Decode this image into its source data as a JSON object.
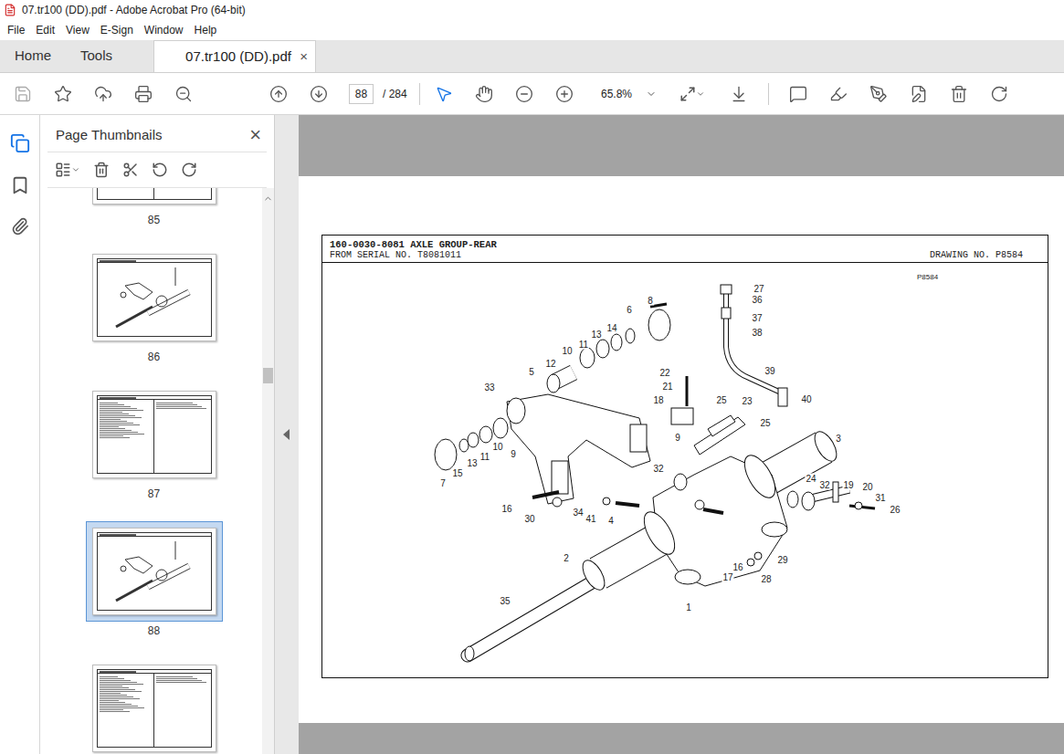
{
  "window": {
    "title": "07.tr100 (DD).pdf - Adobe Acrobat Pro (64-bit)"
  },
  "menu": [
    "File",
    "Edit",
    "View",
    "E-Sign",
    "Window",
    "Help"
  ],
  "tabs": [
    {
      "label": "Home",
      "selected": false
    },
    {
      "label": "Tools",
      "selected": false
    },
    {
      "label": "07.tr100 (DD).pdf",
      "selected": true,
      "close": "×"
    }
  ],
  "toolbar": {
    "page": "88",
    "page_total": "/ 284",
    "zoom": "65.8%"
  },
  "thumbnails_panel": {
    "title": "Page Thumbnails",
    "close": "×",
    "pages": [
      {
        "label": "85",
        "kind": "list",
        "selected": false
      },
      {
        "label": "86",
        "kind": "drawing",
        "selected": false
      },
      {
        "label": "87",
        "kind": "list",
        "selected": false
      },
      {
        "label": "88",
        "kind": "drawing",
        "selected": true
      },
      {
        "kind": "list",
        "selected": false
      }
    ]
  },
  "document": {
    "title": "160-0030-8081 AXLE GROUP-REAR",
    "serial": "FROM SERIAL NO. T8081011",
    "drawing_no": "DRAWING NO. P8584",
    "ref": "P8584",
    "callouts": [
      "27",
      "36",
      "37",
      "38",
      "39",
      "40",
      "8",
      "6",
      "14",
      "13",
      "11",
      "10",
      "12",
      "5",
      "22",
      "21",
      "18",
      "25",
      "23",
      "25",
      "9",
      "33",
      "9",
      "10",
      "11",
      "13",
      "15",
      "7",
      "3",
      "24",
      "32",
      "19",
      "20",
      "31",
      "26",
      "32",
      "16",
      "30",
      "34",
      "41",
      "4",
      "2",
      "29",
      "16",
      "17",
      "28",
      "1",
      "35"
    ]
  }
}
